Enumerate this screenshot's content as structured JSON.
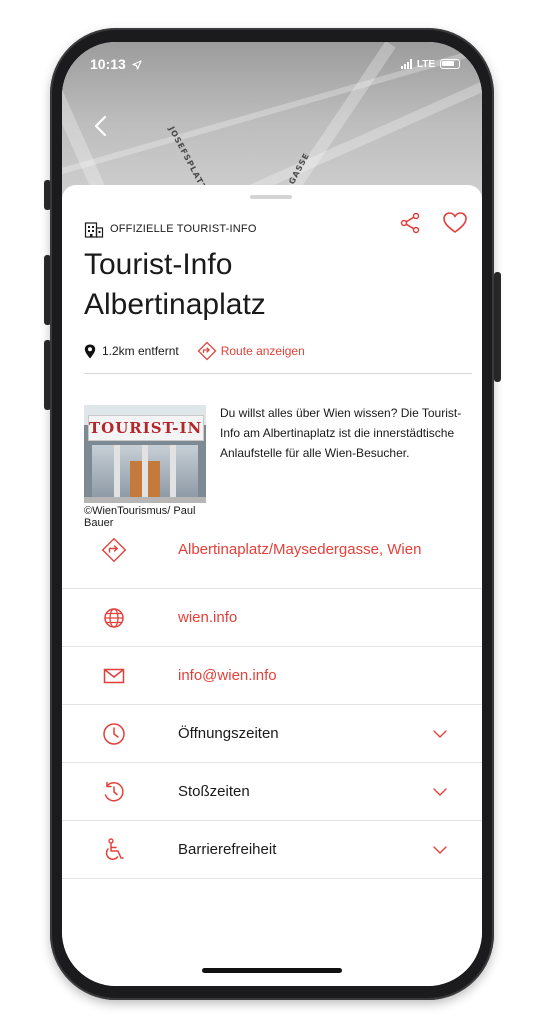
{
  "status_bar": {
    "time": "10:13",
    "network": "LTE"
  },
  "map": {
    "street_labels": [
      "JOSEFSPLATZ",
      "GASSE"
    ]
  },
  "header": {
    "category": "OFFIZIELLE TOURIST-INFO",
    "title_line1": "Tourist-Info",
    "title_line2": "Albertinaplatz",
    "distance": "1.2km entfernt",
    "route_label": "Route anzeigen"
  },
  "intro": {
    "photo_sign": "TOURIST-INFO",
    "photo_credit": "©WienTourismus/ Paul Bauer",
    "description": "Du willst alles über Wien wissen? Die Tourist-Info am Albertinaplatz ist die innerstädtische Anlaufstelle für alle Wien-Besucher."
  },
  "info_items": {
    "address": "Albertinaplatz/Maysedergasse, Wien",
    "website": "wien.info",
    "email": "info@wien.info",
    "opening_hours": "Öffnungszeiten",
    "peak_times": "Stoßzeiten",
    "accessibility": "Barrierefreiheit"
  },
  "icons": {
    "back": "chevron-left-icon",
    "category": "building-icon",
    "share": "share-icon",
    "favorite": "heart-icon",
    "location": "location-pin-icon",
    "route": "route-arrow-icon",
    "address": "route-arrow-icon",
    "website": "globe-icon",
    "email": "mail-icon",
    "opening_hours": "clock-icon",
    "peak_times": "history-clock-icon",
    "accessibility": "wheelchair-icon",
    "expand": "chevron-down-icon"
  },
  "colors": {
    "accent": "#e4403a",
    "text": "#1a1a1a",
    "divider": "#e3e3e3"
  }
}
